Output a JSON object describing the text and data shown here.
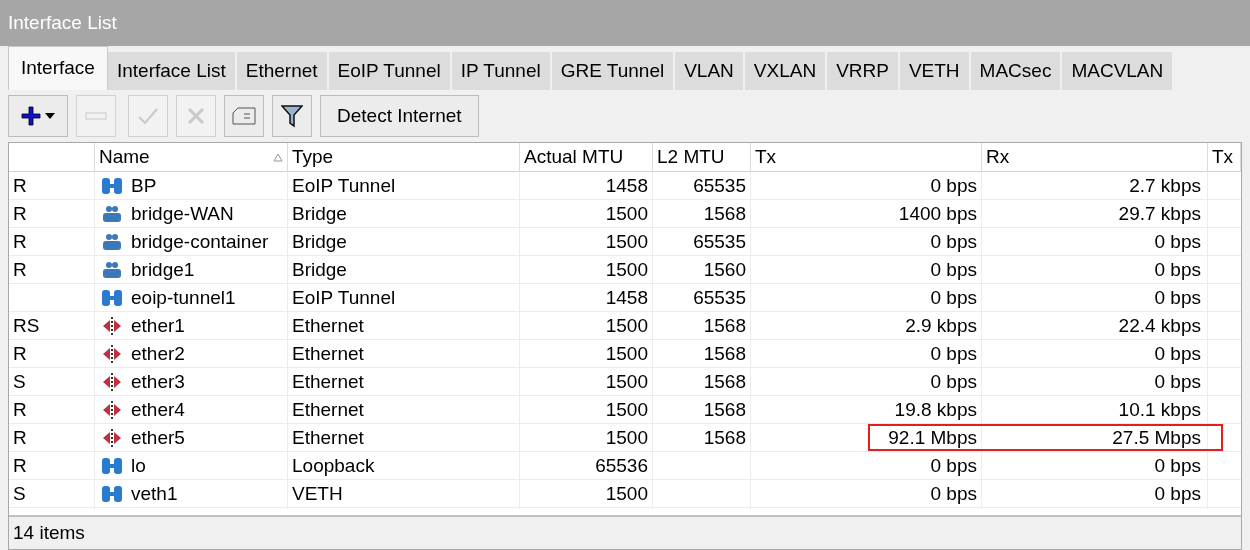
{
  "window": {
    "title": "Interface List"
  },
  "tabs": [
    {
      "label": "Interface",
      "selected": true
    },
    {
      "label": "Interface List",
      "selected": false
    },
    {
      "label": "Ethernet",
      "selected": false
    },
    {
      "label": "EoIP Tunnel",
      "selected": false
    },
    {
      "label": "IP Tunnel",
      "selected": false
    },
    {
      "label": "GRE Tunnel",
      "selected": false
    },
    {
      "label": "VLAN",
      "selected": false
    },
    {
      "label": "VXLAN",
      "selected": false
    },
    {
      "label": "VRRP",
      "selected": false
    },
    {
      "label": "VETH",
      "selected": false
    },
    {
      "label": "MACsec",
      "selected": false
    },
    {
      "label": "MACVLAN",
      "selected": false
    }
  ],
  "toolbar": [
    {
      "kind": "add",
      "disabled": false
    },
    {
      "kind": "remove",
      "disabled": true
    },
    {
      "kind": "enable",
      "disabled": true
    },
    {
      "kind": "disable",
      "disabled": true
    },
    {
      "kind": "comment",
      "disabled": false
    },
    {
      "kind": "filter",
      "disabled": false
    },
    {
      "kind": "text",
      "label": "Detect Internet",
      "disabled": false
    }
  ],
  "table": {
    "columns": [
      "Name",
      "Type",
      "Actual MTU",
      "L2 MTU",
      "Tx",
      "Rx",
      "Tx"
    ],
    "rows": [
      {
        "flags": "R",
        "kind": "tunnel",
        "name": "BP",
        "type": "EoIP Tunnel",
        "actual_mtu": "1458",
        "l2_mtu": "65535",
        "tx": "0 bps",
        "rx": "2.7 kbps",
        "highlighted": false
      },
      {
        "flags": "R",
        "kind": "bridge",
        "name": "bridge-WAN",
        "type": "Bridge",
        "actual_mtu": "1500",
        "l2_mtu": "1568",
        "tx": "1400 bps",
        "rx": "29.7 kbps",
        "highlighted": false
      },
      {
        "flags": "R",
        "kind": "bridge",
        "name": "bridge-container",
        "type": "Bridge",
        "actual_mtu": "1500",
        "l2_mtu": "65535",
        "tx": "0 bps",
        "rx": "0 bps",
        "highlighted": false
      },
      {
        "flags": "R",
        "kind": "bridge",
        "name": "bridge1",
        "type": "Bridge",
        "actual_mtu": "1500",
        "l2_mtu": "1560",
        "tx": "0 bps",
        "rx": "0 bps",
        "highlighted": false
      },
      {
        "flags": "",
        "kind": "tunnel",
        "name": "eoip-tunnel1",
        "type": "EoIP Tunnel",
        "actual_mtu": "1458",
        "l2_mtu": "65535",
        "tx": "0 bps",
        "rx": "0 bps",
        "highlighted": false
      },
      {
        "flags": "RS",
        "kind": "ethernet",
        "name": "ether1",
        "type": "Ethernet",
        "actual_mtu": "1500",
        "l2_mtu": "1568",
        "tx": "2.9 kbps",
        "rx": "22.4 kbps",
        "highlighted": false
      },
      {
        "flags": "R",
        "kind": "ethernet",
        "name": "ether2",
        "type": "Ethernet",
        "actual_mtu": "1500",
        "l2_mtu": "1568",
        "tx": "0 bps",
        "rx": "0 bps",
        "highlighted": false
      },
      {
        "flags": "S",
        "kind": "ethernet",
        "name": "ether3",
        "type": "Ethernet",
        "actual_mtu": "1500",
        "l2_mtu": "1568",
        "tx": "0 bps",
        "rx": "0 bps",
        "highlighted": false
      },
      {
        "flags": "R",
        "kind": "ethernet",
        "name": "ether4",
        "type": "Ethernet",
        "actual_mtu": "1500",
        "l2_mtu": "1568",
        "tx": "19.8 kbps",
        "rx": "10.1 kbps",
        "highlighted": false
      },
      {
        "flags": "R",
        "kind": "ethernet",
        "name": "ether5",
        "type": "Ethernet",
        "actual_mtu": "1500",
        "l2_mtu": "1568",
        "tx": "92.1 Mbps",
        "rx": "27.5 Mbps",
        "highlighted": true
      },
      {
        "flags": "R",
        "kind": "tunnel",
        "name": "lo",
        "type": "Loopback",
        "actual_mtu": "65536",
        "l2_mtu": "",
        "tx": "0 bps",
        "rx": "0 bps",
        "highlighted": false
      },
      {
        "flags": "S",
        "kind": "tunnel",
        "name": "veth1",
        "type": "VETH",
        "actual_mtu": "1500",
        "l2_mtu": "",
        "tx": "0 bps",
        "rx": "0 bps",
        "highlighted": false
      }
    ]
  },
  "status_bar": {
    "text": "14 items"
  }
}
